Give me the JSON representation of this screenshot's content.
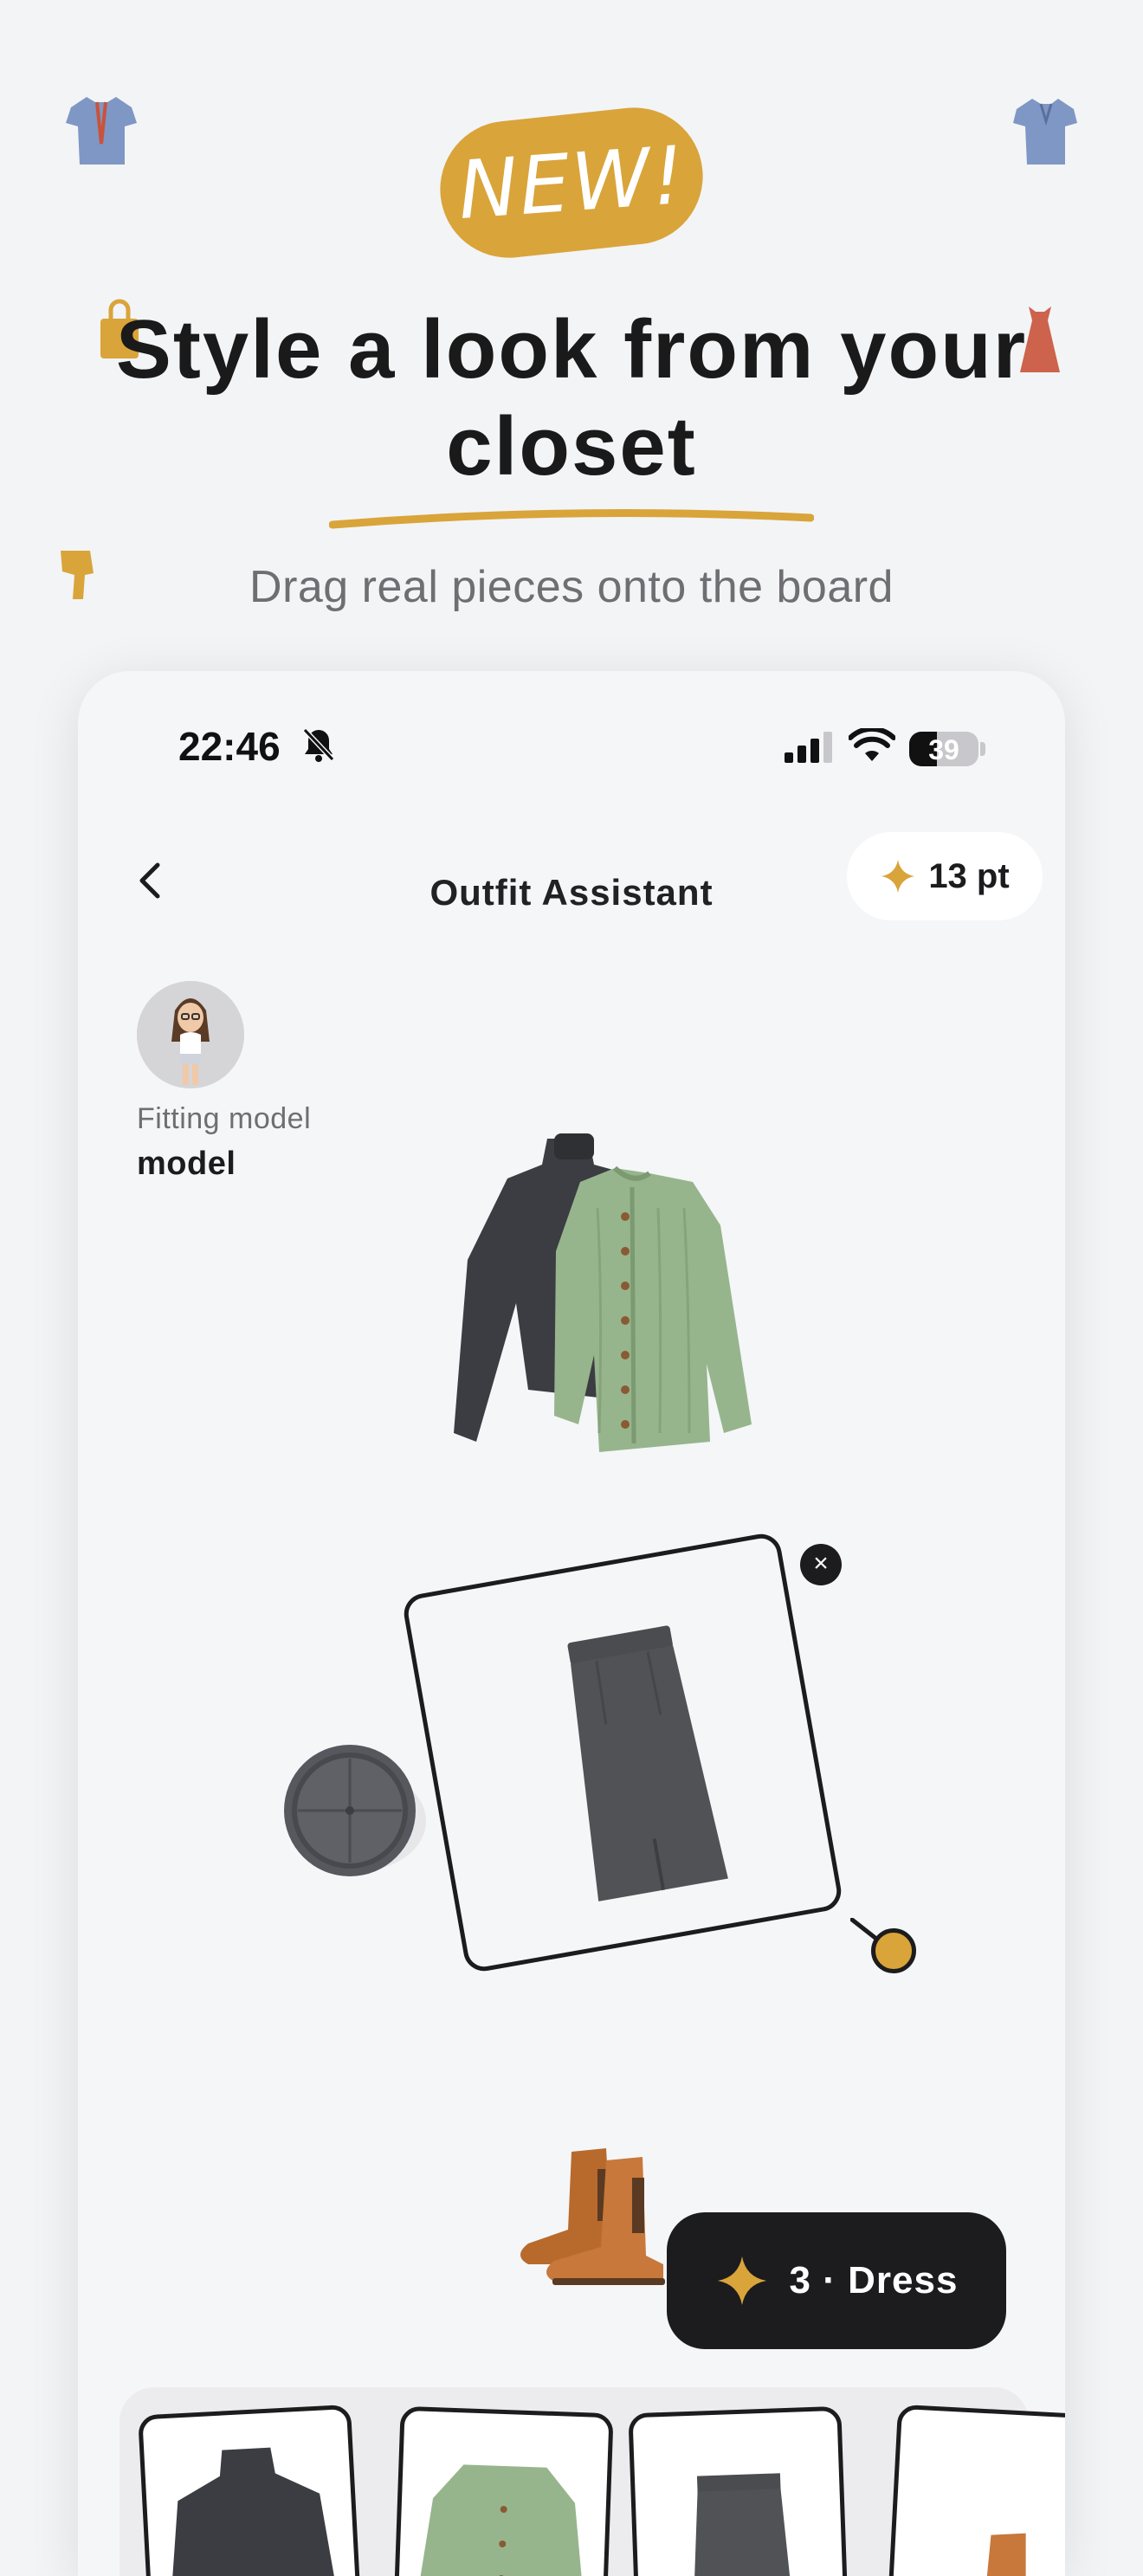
{
  "colors": {
    "accent": "#d9a43a",
    "dark": "#1c1c1e",
    "muted": "#6e6e73",
    "background": "#f3f4f6"
  },
  "promo": {
    "badge": "NEW!",
    "headline_line1": "Style a look from your",
    "headline_line2": "closet",
    "subline": "Drag real pieces onto the board"
  },
  "status_bar": {
    "time": "22:46",
    "battery": "39",
    "icons": [
      "bell-slash-icon",
      "signal-icon",
      "wifi-icon",
      "battery-icon"
    ]
  },
  "header": {
    "back_icon": "chevron-left-icon",
    "title": "Outfit Assistant",
    "points_icon": "sparkle-icon",
    "points": "13 pt"
  },
  "model": {
    "caption": "Fitting model",
    "name": "model"
  },
  "board": {
    "items": [
      "sweater-layer-item",
      "skirt-item",
      "beret-item",
      "boots-item"
    ],
    "close_icon": "close-icon",
    "close_glyph": "×"
  },
  "dress_button": {
    "icon": "sparkle-icon",
    "label": "3 · Dress"
  },
  "tray": {
    "items": [
      "turtleneck-thumb",
      "cardigan-thumb",
      "skirt-thumb",
      "boots-thumb"
    ]
  }
}
